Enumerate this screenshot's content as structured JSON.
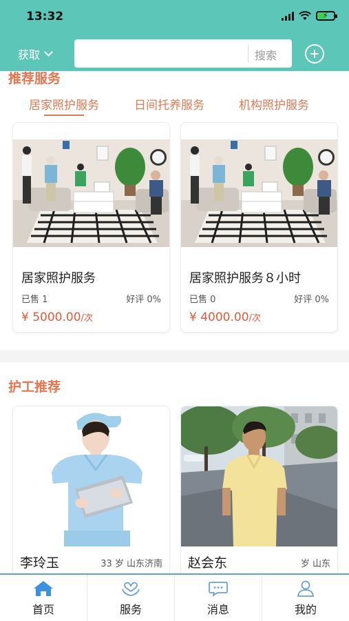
{
  "status_bar": {
    "time": "13:32"
  },
  "header": {
    "location_label": "获取",
    "search_placeholder": "",
    "search_button": "搜索",
    "add_icon": "plus-circle-icon"
  },
  "sections": {
    "services_title": "推荐服务",
    "caregivers_title": "护工推荐"
  },
  "service_tabs": [
    {
      "label": "居家照护服务",
      "active": true
    },
    {
      "label": "日间托养服务",
      "active": false
    },
    {
      "label": "机构照护服务",
      "active": false
    }
  ],
  "services": [
    {
      "title": "居家照护服务",
      "sold": "已售  1",
      "rating": "好评  0%",
      "price": "¥ 5000.00",
      "unit": "/次"
    },
    {
      "title": "居家照护服务８小时",
      "sold": "已售  0",
      "rating": "好评  0%",
      "price": "¥ 4000.00",
      "unit": "/次"
    }
  ],
  "caregivers": [
    {
      "name": "李玲玉",
      "info": "33 岁  山东济南"
    },
    {
      "name": "赵会东",
      "info": "岁  山东"
    }
  ],
  "tabbar": [
    {
      "label": "首页",
      "icon": "home-icon",
      "active": true
    },
    {
      "label": "服务",
      "icon": "heart-hands-icon",
      "active": false
    },
    {
      "label": "消息",
      "icon": "chat-bubble-icon",
      "active": false
    },
    {
      "label": "我的",
      "icon": "user-icon",
      "active": false
    }
  ],
  "colors": {
    "header": "#5cc6b8",
    "accent": "#e8744e",
    "price": "#e25a3a",
    "tab_active": "#3d8fe0"
  }
}
